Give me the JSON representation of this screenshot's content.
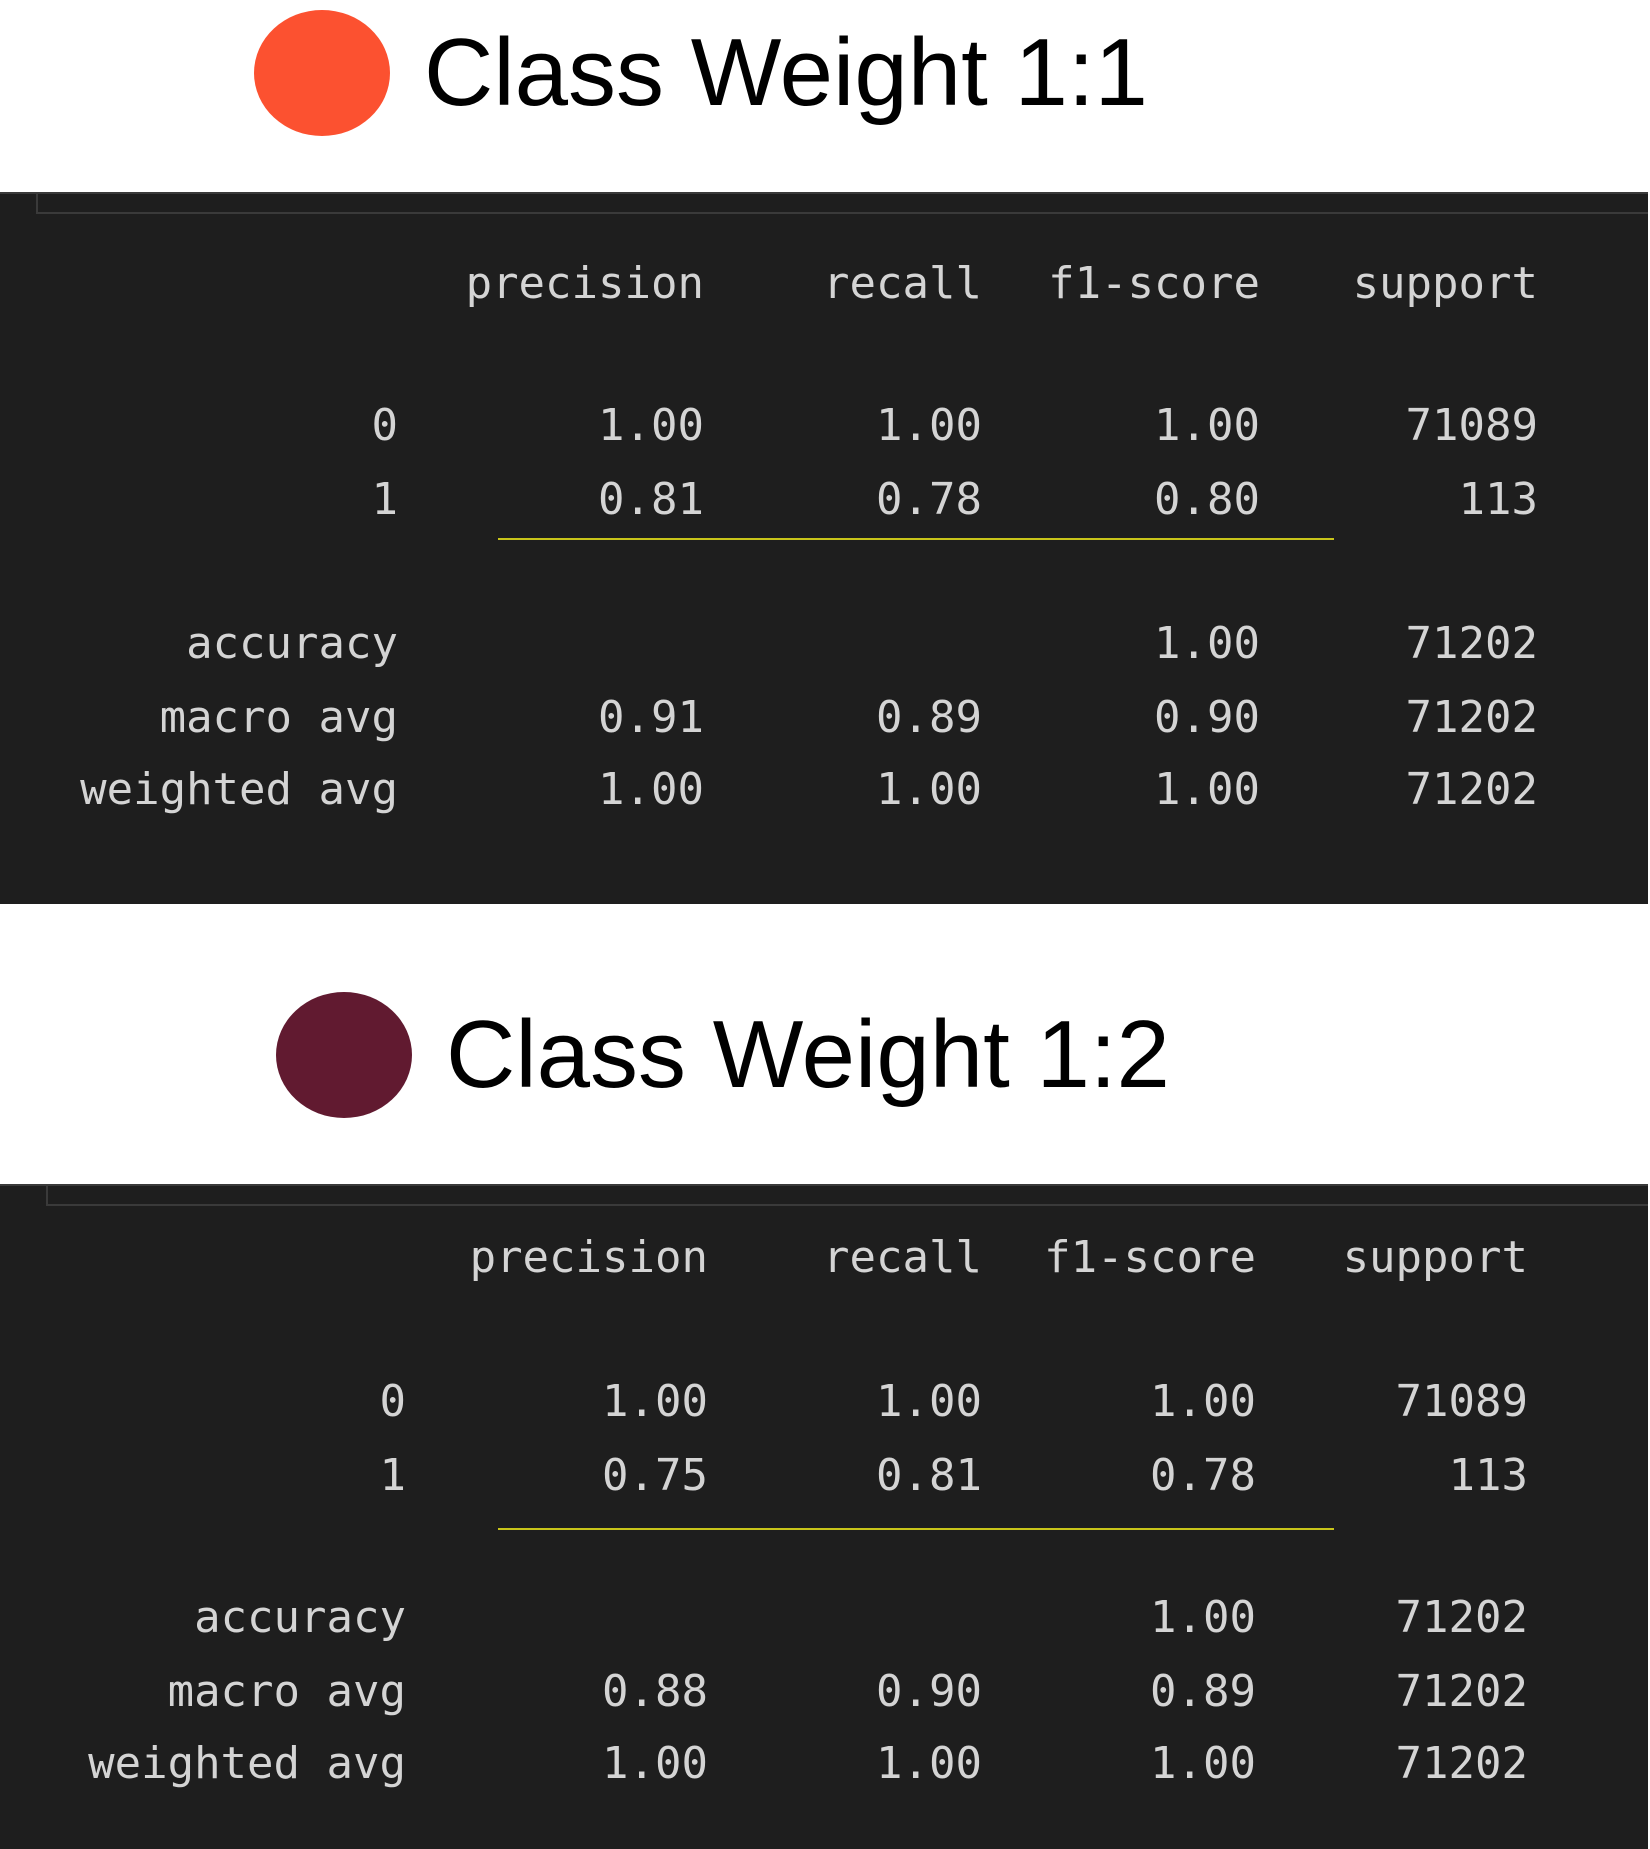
{
  "reports": [
    {
      "heading": "Class Weight 1:1",
      "dot_color": "#fc5130",
      "columns": [
        "precision",
        "recall",
        "f1-score",
        "support"
      ],
      "rows": [
        {
          "label": "0",
          "precision": "1.00",
          "recall": "1.00",
          "f1": "1.00",
          "support": "71089"
        },
        {
          "label": "1",
          "precision": "0.81",
          "recall": "0.78",
          "f1": "0.80",
          "support": "113"
        },
        {
          "label": "accuracy",
          "precision": "",
          "recall": "",
          "f1": "1.00",
          "support": "71202"
        },
        {
          "label": "macro avg",
          "precision": "0.91",
          "recall": "0.89",
          "f1": "0.90",
          "support": "71202"
        },
        {
          "label": "weighted avg",
          "precision": "1.00",
          "recall": "1.00",
          "f1": "1.00",
          "support": "71202"
        }
      ]
    },
    {
      "heading": "Class Weight 1:2",
      "dot_color": "#611a30",
      "columns": [
        "precision",
        "recall",
        "f1-score",
        "support"
      ],
      "rows": [
        {
          "label": "0",
          "precision": "1.00",
          "recall": "1.00",
          "f1": "1.00",
          "support": "71089"
        },
        {
          "label": "1",
          "precision": "0.75",
          "recall": "0.81",
          "f1": "0.78",
          "support": "113"
        },
        {
          "label": "accuracy",
          "precision": "",
          "recall": "",
          "f1": "1.00",
          "support": "71202"
        },
        {
          "label": "macro avg",
          "precision": "0.88",
          "recall": "0.90",
          "f1": "0.89",
          "support": "71202"
        },
        {
          "label": "weighted avg",
          "precision": "1.00",
          "recall": "1.00",
          "f1": "1.00",
          "support": "71202"
        }
      ]
    }
  ],
  "colors": {
    "panel_bg": "#1e1e1e",
    "text": "#d4d4d4",
    "rule": "#c8c41a"
  }
}
